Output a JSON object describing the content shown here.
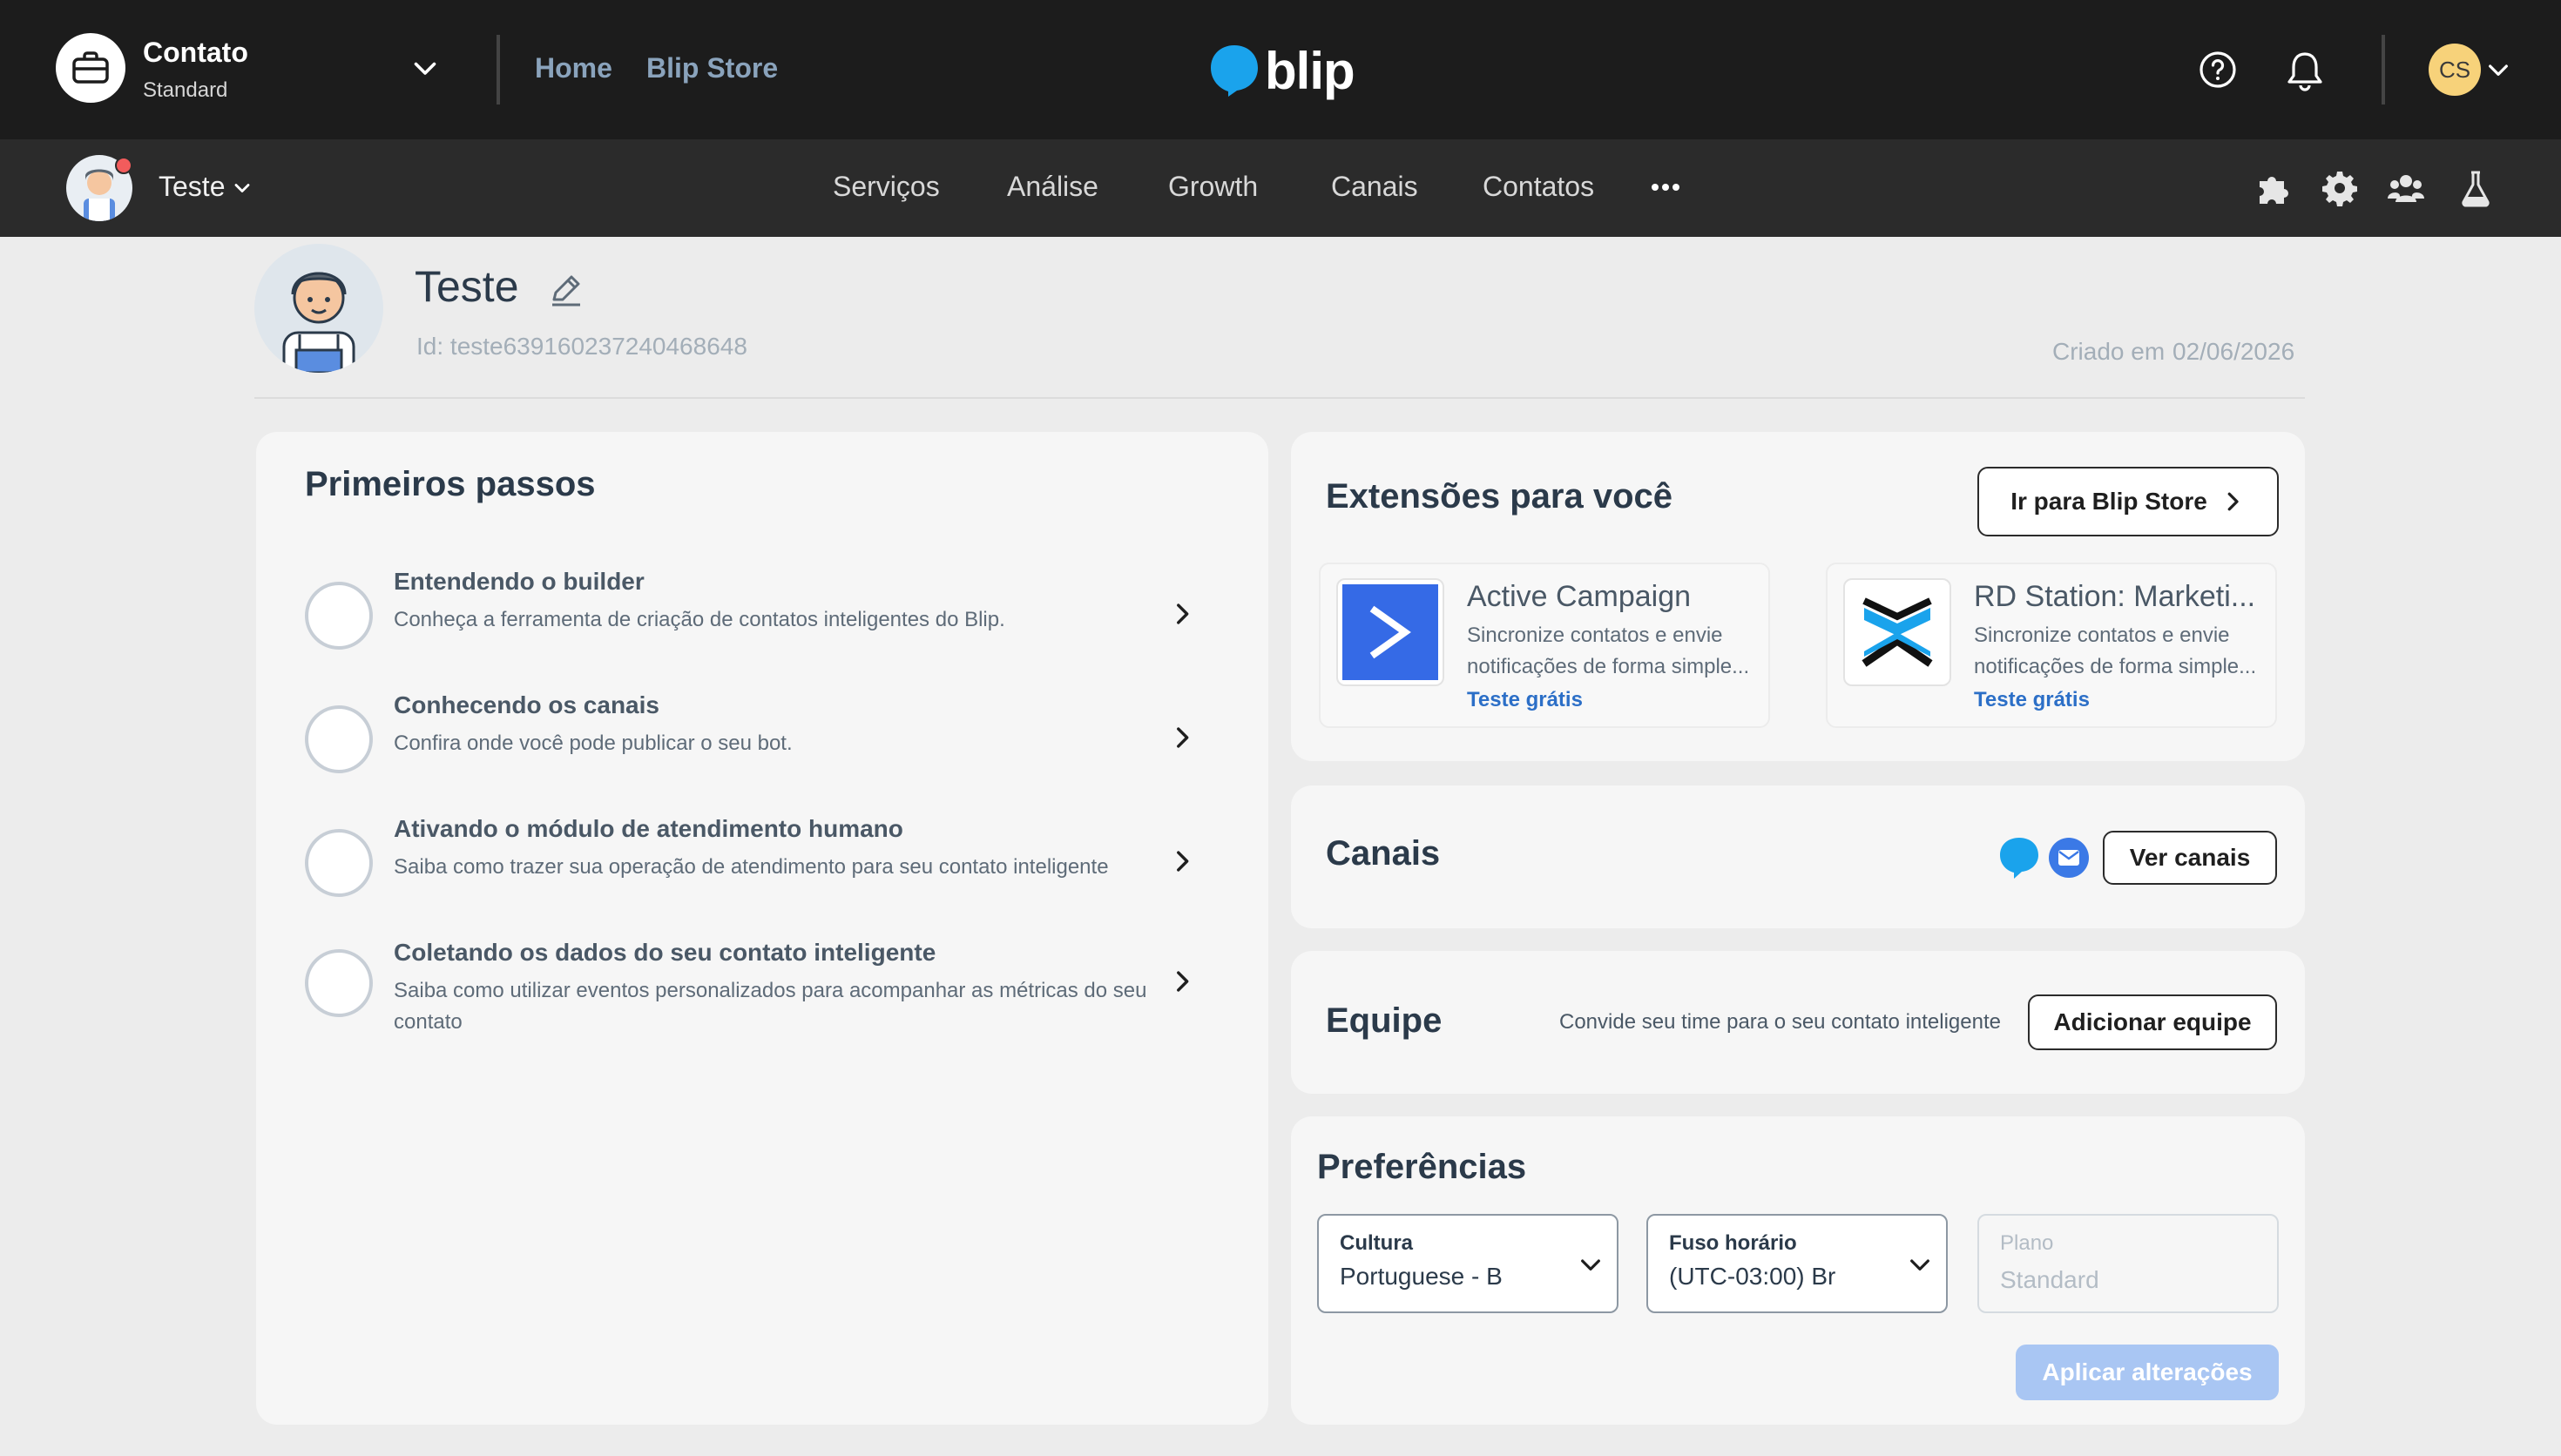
{
  "topbar": {
    "org_name": "Contato",
    "org_plan": "Standard",
    "links": {
      "home": "Home",
      "store": "Blip Store"
    },
    "logo_text": "blip",
    "user_initials": "CS"
  },
  "subbar": {
    "bot_name": "Teste",
    "nav": [
      "Serviços",
      "Análise",
      "Growth",
      "Canais",
      "Contatos"
    ]
  },
  "bot": {
    "name": "Teste",
    "id": "Id: teste639160237240468648",
    "created_label": "Criado em",
    "created_value": "02/06/2026"
  },
  "steps": {
    "title": "Primeiros passos",
    "items": [
      {
        "title": "Entendendo o builder",
        "desc": "Conheça a ferramenta de criação de contatos inteligentes do Blip."
      },
      {
        "title": "Conhecendo os canais",
        "desc": "Confira onde você pode publicar o seu bot."
      },
      {
        "title": "Ativando o módulo de atendimento humano",
        "desc": "Saiba como trazer sua operação de atendimento para seu contato inteligente"
      },
      {
        "title": "Coletando os dados do seu contato inteligente",
        "desc": "Saiba como utilizar eventos personalizados para acompanhar as métricas do seu contato"
      }
    ]
  },
  "extensions": {
    "title": "Extensões para você",
    "store_button": "Ir para Blip Store",
    "items": [
      {
        "name": "Active Campaign",
        "desc_line1": "Sincronize contatos e envie",
        "desc_line2": "notificações de forma simple...",
        "cta": "Teste grátis"
      },
      {
        "name": "RD Station: Marketi...",
        "desc_line1": "Sincronize contatos e envie",
        "desc_line2": "notificações de forma simple...",
        "cta": "Teste grátis"
      }
    ]
  },
  "canais": {
    "title": "Canais",
    "button": "Ver canais"
  },
  "equipe": {
    "title": "Equipe",
    "desc": "Convide seu time para o seu contato inteligente",
    "button": "Adicionar equipe"
  },
  "preferences": {
    "title": "Preferências",
    "cultura": {
      "label": "Cultura",
      "value": "Portuguese - B"
    },
    "fuso": {
      "label": "Fuso horário",
      "value": "(UTC-03:00) Br"
    },
    "plano": {
      "label": "Plano",
      "value": "Standard"
    },
    "apply_button": "Aplicar alterações"
  },
  "colors": {
    "topbar_bg": "#1c1c1c",
    "subbar_bg": "#2b2b2b",
    "accent_blue": "#2c6fc7",
    "blip_blue": "#1aa3ec",
    "apply_disabled": "#a9c6f3"
  }
}
